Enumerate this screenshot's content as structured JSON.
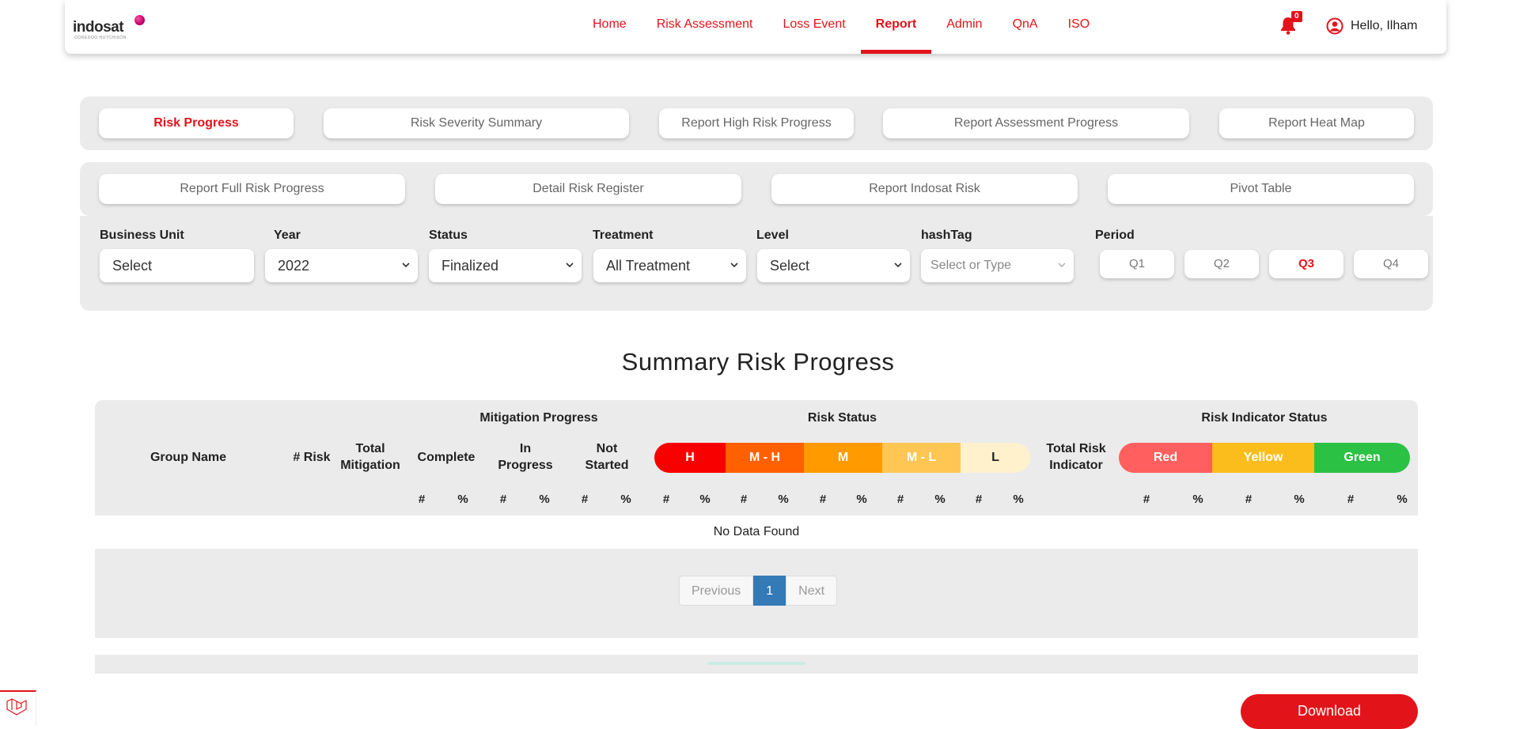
{
  "header": {
    "brand": "indosat",
    "brand_sub": "OOREDOO HUTCHISON",
    "nav": [
      "Home",
      "Risk Assessment",
      "Loss Event",
      "Report",
      "Admin",
      "QnA",
      "ISO"
    ],
    "active_nav": "Report",
    "notification_count": "0",
    "greeting": "Hello, Ilham"
  },
  "report_tabs": {
    "row1": [
      "Risk Progress",
      "Risk Severity Summary",
      "Report High Risk Progress",
      "Report Assessment Progress",
      "Report Heat Map"
    ],
    "row2": [
      "Report Full Risk Progress",
      "Detail Risk Register",
      "Report Indosat Risk",
      "Pivot Table"
    ],
    "active": "Risk Progress"
  },
  "filters": {
    "business_unit": {
      "label": "Business Unit",
      "value": "Select"
    },
    "year": {
      "label": "Year",
      "value": "2022"
    },
    "status": {
      "label": "Status",
      "value": "Finalized"
    },
    "treatment": {
      "label": "Treatment",
      "value": "All Treatment"
    },
    "level": {
      "label": "Level",
      "value": "Select"
    },
    "hashtag": {
      "label": "hashTag",
      "placeholder": "Select or Type"
    },
    "period": {
      "label": "Period",
      "options": [
        "Q1",
        "Q2",
        "Q3",
        "Q4"
      ],
      "active": "Q3"
    }
  },
  "summary": {
    "title": "Summary Risk Progress",
    "headers": {
      "group_name": "Group Name",
      "risk": "# Risk",
      "total_mitigation": "Total Mitigation",
      "mitigation_progress": "Mitigation Progress",
      "complete": "Complete",
      "in_progress": "In Progress",
      "not_started": "Not Started",
      "risk_status": "Risk Status",
      "total_risk_indicator": "Total Risk Indicator",
      "risk_indicator_status": "Risk Indicator Status"
    },
    "risk_levels": [
      "H",
      "M - H",
      "M",
      "M - L",
      "L"
    ],
    "indicator_levels": [
      "Red",
      "Yellow",
      "Green"
    ],
    "count_symbol": "#",
    "percent_symbol": "%",
    "empty_message": "No Data Found"
  },
  "pagination": {
    "previous": "Previous",
    "current": "1",
    "next": "Next"
  },
  "download_label": "Download",
  "colors": {
    "brand_red": "#e3131a",
    "risk_h": "#f90000",
    "risk_mh": "#ff6000",
    "risk_m": "#ff9a00",
    "risk_ml": "#ffc654",
    "risk_l": "#fff1cc",
    "ind_red": "#ff5f5f",
    "ind_yellow": "#fbbd1c",
    "ind_green": "#2bc144"
  }
}
